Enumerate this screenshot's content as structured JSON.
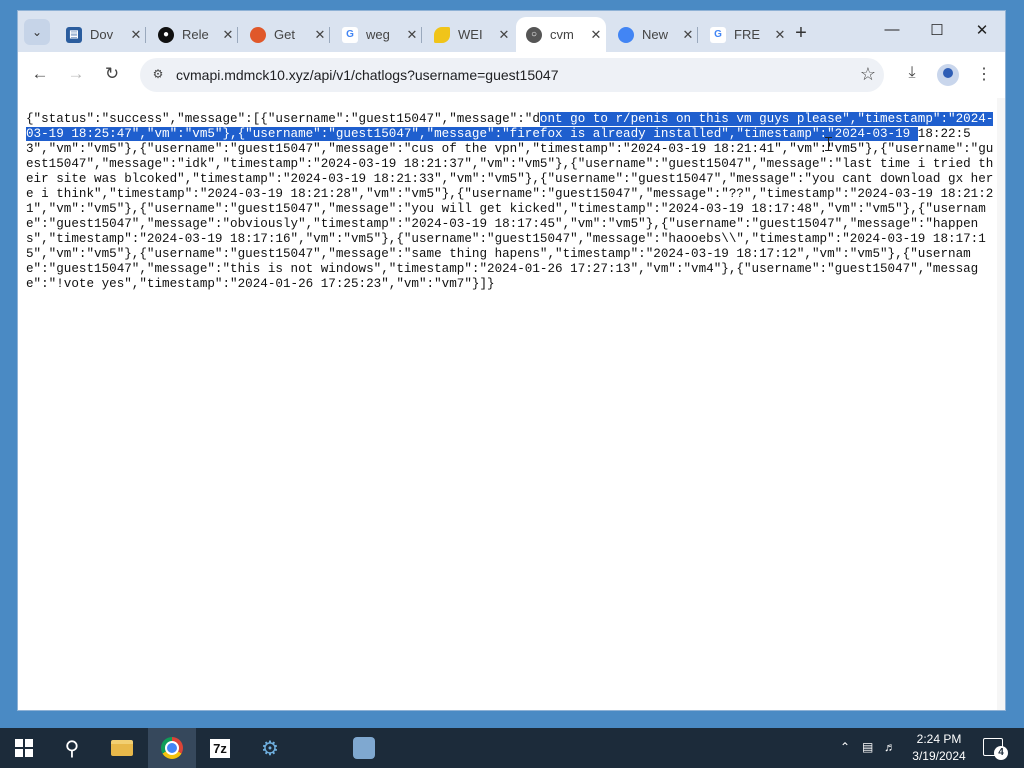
{
  "browser": {
    "tabs": [
      {
        "title": "Dov",
        "favicon": "chart-icon",
        "color": "#2b5d9e"
      },
      {
        "title": "Rele",
        "favicon": "github-icon",
        "color": "#111111"
      },
      {
        "title": "Get",
        "favicon": "firefox-icon",
        "color": "#e0582a"
      },
      {
        "title": "weg",
        "favicon": "google-icon",
        "color": "#4285f4"
      },
      {
        "title": "WEI",
        "favicon": "banana-icon",
        "color": "#f0c419"
      },
      {
        "title": "cvm",
        "favicon": "globe-icon",
        "color": "#555555"
      },
      {
        "title": "New",
        "favicon": "chrome-icon",
        "color": "#4285f4"
      },
      {
        "title": "FRE",
        "favicon": "google-icon",
        "color": "#4285f4"
      }
    ],
    "active_tab_index": 5,
    "new_tab_label": "+",
    "url": "cvmapi.mdmck10.xyz/api/v1/chatlogs?username=guest15047"
  },
  "content": {
    "before_selection": "{\"status\":\"success\",\"message\":[{\"username\":\"guest15047\",\"message\":\"d",
    "selected_text": "ont go to r/penis on this vm guys please\",\"timestamp\":\"2024-03-19 18:25:47\",\"vm\":\"vm5\"},{\"username\":\"guest15047\",\"message\":\"firefox is already installed\",\"timestamp\":\"2024-03-19 ",
    "after_selection": "18:22:53\",\"vm\":\"vm5\"},{\"username\":\"guest15047\",\"message\":\"cus of the vpn\",\"timestamp\":\"2024-03-19 18:21:41\",\"vm\":\"vm5\"},{\"username\":\"guest15047\",\"message\":\"idk\",\"timestamp\":\"2024-03-19 18:21:37\",\"vm\":\"vm5\"},{\"username\":\"guest15047\",\"message\":\"last time i tried their site was blcoked\",\"timestamp\":\"2024-03-19 18:21:33\",\"vm\":\"vm5\"},{\"username\":\"guest15047\",\"message\":\"you cant download gx here i think\",\"timestamp\":\"2024-03-19 18:21:28\",\"vm\":\"vm5\"},{\"username\":\"guest15047\",\"message\":\"??\",\"timestamp\":\"2024-03-19 18:21:21\",\"vm\":\"vm5\"},{\"username\":\"guest15047\",\"message\":\"you will get kicked\",\"timestamp\":\"2024-03-19 18:17:48\",\"vm\":\"vm5\"},{\"username\":\"guest15047\",\"message\":\"obviously\",\"timestamp\":\"2024-03-19 18:17:45\",\"vm\":\"vm5\"},{\"username\":\"guest15047\",\"message\":\"happens\",\"timestamp\":\"2024-03-19 18:17:16\",\"vm\":\"vm5\"},{\"username\":\"guest15047\",\"message\":\"haooebs\\\\\",\"timestamp\":\"2024-03-19 18:17:15\",\"vm\":\"vm5\"},{\"username\":\"guest15047\",\"message\":\"same thing hapens\",\"timestamp\":\"2024-03-19 18:17:12\",\"vm\":\"vm5\"},{\"username\":\"guest15047\",\"message\":\"this is not windows\",\"timestamp\":\"2024-01-26 17:27:13\",\"vm\":\"vm4\"},{\"username\":\"guest15047\",\"message\":\"!vote yes\",\"timestamp\":\"2024-01-26 17:25:23\",\"vm\":\"vm7\"}]}"
  },
  "taskbar": {
    "time": "2:24 PM",
    "date": "3/19/2024",
    "notification_count": "4"
  },
  "colors": {
    "selection": "#1f5fce",
    "taskbar": "#1c2b3a",
    "tabstrip": "#dae3f0"
  }
}
